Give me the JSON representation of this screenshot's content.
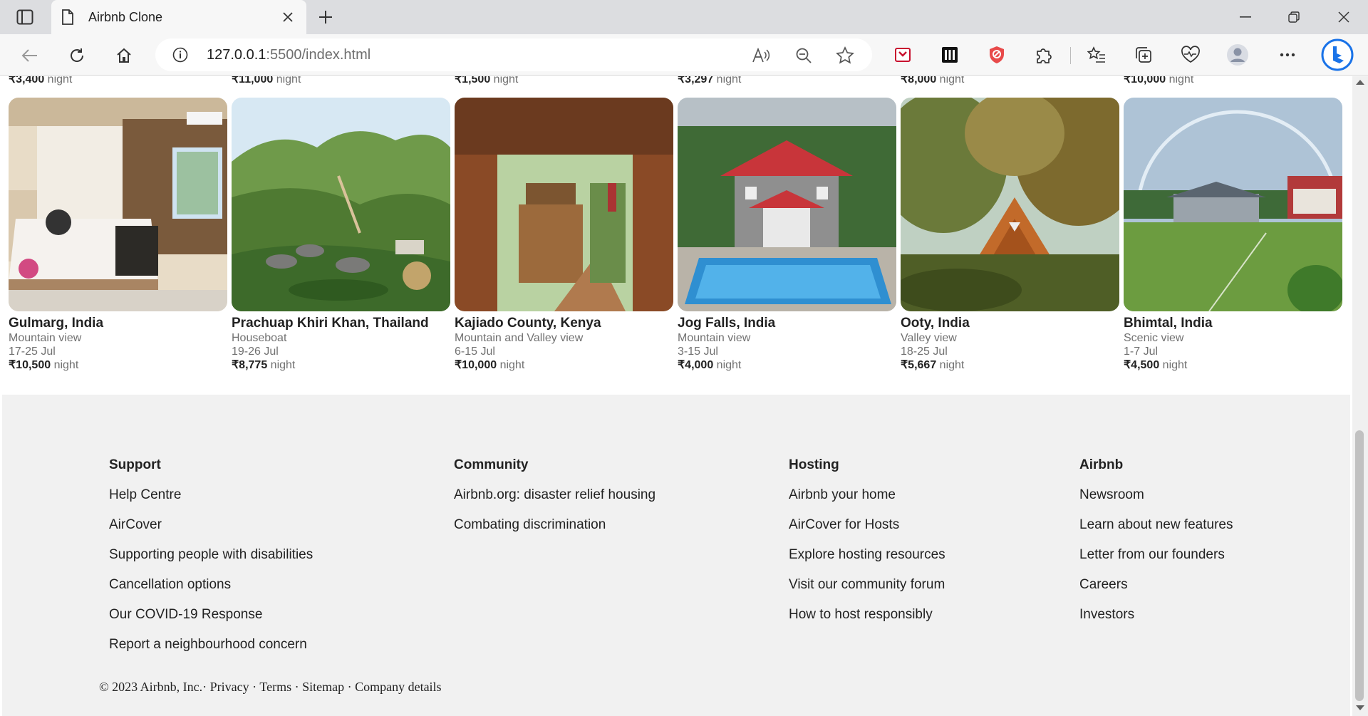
{
  "browser": {
    "tab_title": "Airbnb Clone",
    "url_host": "127.0.0.1",
    "url_path": ":5500/index.html"
  },
  "previous_row_prices": [
    {
      "amount": "₹3,400",
      "unit": "night"
    },
    {
      "amount": "₹11,000",
      "unit": "night"
    },
    {
      "amount": "₹1,500",
      "unit": "night"
    },
    {
      "amount": "₹3,297",
      "unit": "night"
    },
    {
      "amount": "₹8,000",
      "unit": "night"
    },
    {
      "amount": "₹10,000",
      "unit": "night"
    }
  ],
  "listings": [
    {
      "name": "Gulmarg, India",
      "view": "Mountain view",
      "dates": "17-25 Jul",
      "price": "₹10,500",
      "unit": "night",
      "photo": "bedroom-photo"
    },
    {
      "name": "Prachuap Khiri Khan, Thailand",
      "view": "Houseboat",
      "dates": "19-26 Jul",
      "price": "₹8,775",
      "unit": "night",
      "photo": "hillside-resort-photo"
    },
    {
      "name": "Kajiado County, Kenya",
      "view": "Mountain and Valley view",
      "dates": "6-15 Jul",
      "price": "₹10,000",
      "unit": "night",
      "photo": "wooden-doorway-photo"
    },
    {
      "name": "Jog Falls, India",
      "view": "Mountain view",
      "dates": "3-15 Jul",
      "price": "₹4,000",
      "unit": "night",
      "photo": "villa-pool-photo"
    },
    {
      "name": "Ooty, India",
      "view": "Valley view",
      "dates": "18-25 Jul",
      "price": "₹5,667",
      "unit": "night",
      "photo": "a-frame-cabin-photo"
    },
    {
      "name": "Bhimtal, India",
      "view": "Scenic view",
      "dates": "1-7 Jul",
      "price": "₹4,500",
      "unit": "night",
      "photo": "garden-rainbow-photo"
    }
  ],
  "footer": {
    "columns": [
      {
        "heading": "Support",
        "links": [
          "Help Centre",
          "AirCover",
          "Supporting people with disabilities",
          "Cancellation options",
          "Our COVID-19 Response",
          "Report a neighbourhood concern"
        ]
      },
      {
        "heading": "Community",
        "links": [
          "Airbnb.org: disaster relief housing",
          "Combating discrimination"
        ]
      },
      {
        "heading": "Hosting",
        "links": [
          "Airbnb your home",
          "AirCover for Hosts",
          "Explore hosting resources",
          "Visit our community forum",
          "How to host responsibly"
        ]
      },
      {
        "heading": "Airbnb",
        "links": [
          "Newsroom",
          "Learn about new features",
          "Letter from our founders",
          "Careers",
          "Investors"
        ]
      }
    ],
    "legal": {
      "copyright": "© 2023 Airbnb, Inc.",
      "privacy": "Privacy",
      "terms": "Terms",
      "sitemap": "Sitemap",
      "company": "Company details",
      "separator": "·"
    }
  },
  "colors": {
    "text": "#222222",
    "muted": "#717171",
    "footer_bg": "#f1f1f1",
    "chrome": "#dcdde0"
  }
}
